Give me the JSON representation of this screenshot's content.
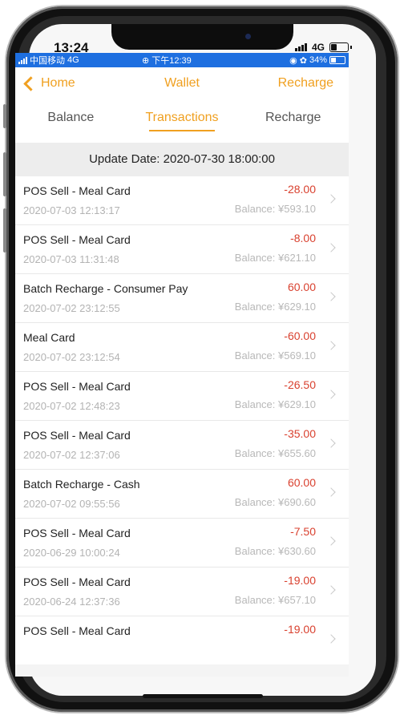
{
  "ios_status": {
    "time": "13:24",
    "network": "4G"
  },
  "android_status": {
    "carrier": "中国移动",
    "network": "4G",
    "time": "下午12:39",
    "battery": "34%"
  },
  "nav": {
    "back_label": "Home",
    "title": "Wallet",
    "action_label": "Recharge"
  },
  "tabs": [
    {
      "label": "Balance",
      "active": false
    },
    {
      "label": "Transactions",
      "active": true
    },
    {
      "label": "Recharge",
      "active": false
    }
  ],
  "update_date": "Update Date: 2020-07-30 18:00:00",
  "transactions": [
    {
      "title": "POS Sell - Meal Card",
      "date": "2020-07-03 12:13:17",
      "amount": "-28.00",
      "balance": "Balance: ¥593.10"
    },
    {
      "title": "POS Sell - Meal Card",
      "date": "2020-07-03 11:31:48",
      "amount": "-8.00",
      "balance": "Balance: ¥621.10"
    },
    {
      "title": "Batch Recharge - Consumer Pay",
      "date": "2020-07-02 23:12:55",
      "amount": "60.00",
      "balance": "Balance: ¥629.10"
    },
    {
      "title": "Meal Card",
      "date": "2020-07-02 23:12:54",
      "amount": "-60.00",
      "balance": "Balance: ¥569.10"
    },
    {
      "title": "POS Sell - Meal Card",
      "date": "2020-07-02 12:48:23",
      "amount": "-26.50",
      "balance": "Balance: ¥629.10"
    },
    {
      "title": "POS Sell - Meal Card",
      "date": "2020-07-02 12:37:06",
      "amount": "-35.00",
      "balance": "Balance: ¥655.60"
    },
    {
      "title": "Batch Recharge - Cash",
      "date": "2020-07-02 09:55:56",
      "amount": "60.00",
      "balance": "Balance: ¥690.60"
    },
    {
      "title": "POS Sell - Meal Card",
      "date": "2020-06-29 10:00:24",
      "amount": "-7.50",
      "balance": "Balance: ¥630.60"
    },
    {
      "title": "POS Sell - Meal Card",
      "date": "2020-06-24 12:37:36",
      "amount": "-19.00",
      "balance": "Balance: ¥657.10"
    },
    {
      "title": "POS Sell - Meal Card",
      "date": "",
      "amount": "-19.00",
      "balance": ""
    }
  ],
  "colors": {
    "accent": "#f0a020",
    "negative": "#d9412f",
    "android_bar": "#1e6fe0"
  }
}
